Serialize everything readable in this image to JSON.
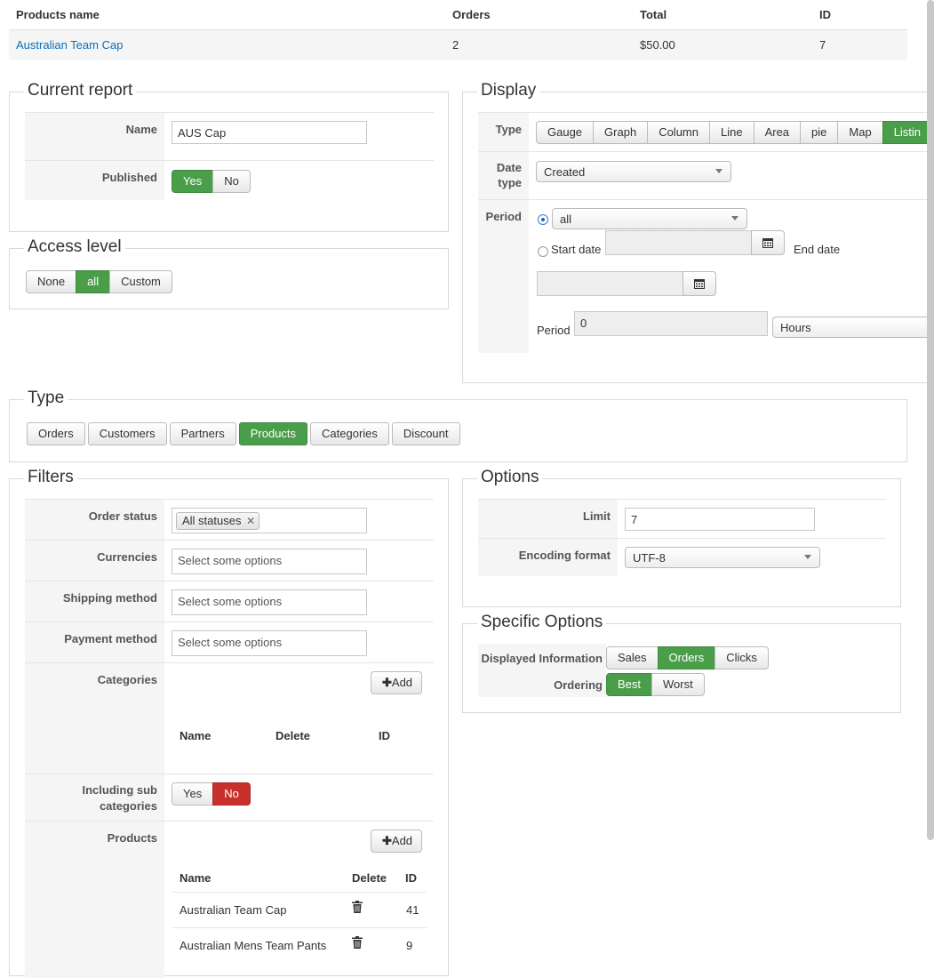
{
  "top_table": {
    "headers": [
      "Products name",
      "Orders",
      "Total",
      "ID"
    ],
    "row": {
      "name": "Australian Team Cap",
      "orders": "2",
      "total": "$50.00",
      "id": "7"
    }
  },
  "current_report": {
    "legend": "Current report",
    "name_label": "Name",
    "name_value": "AUS Cap",
    "published_label": "Published",
    "published_options": [
      "Yes",
      "No"
    ],
    "published_selected": "Yes"
  },
  "access_level": {
    "legend": "Access level",
    "options": [
      "None",
      "all",
      "Custom"
    ],
    "selected": "all"
  },
  "display": {
    "legend": "Display",
    "type_label": "Type",
    "type_options": [
      "Gauge",
      "Graph",
      "Column",
      "Line",
      "Area",
      "pie",
      "Map",
      "Listin"
    ],
    "type_selected": "Listin",
    "date_type_label": "Date type",
    "date_type_value": "Created",
    "period_label": "Period",
    "period_value": "all",
    "start_date_label": "Start date",
    "end_date_label": "End date",
    "period_amount_label": "Period",
    "period_amount_value": "0",
    "period_unit": "Hours"
  },
  "type_section": {
    "legend": "Type",
    "options": [
      "Orders",
      "Customers",
      "Partners",
      "Products",
      "Categories",
      "Discount"
    ],
    "selected": "Products"
  },
  "filters": {
    "legend": "Filters",
    "order_status_label": "Order status",
    "order_status_tag": "All statuses",
    "currencies_label": "Currencies",
    "shipping_label": "Shipping method",
    "payment_label": "Payment method",
    "placeholder": "Select some options",
    "categories_label": "Categories",
    "add_label": "Add",
    "categories_headers": [
      "Name",
      "Delete",
      "ID"
    ],
    "sub_categories_label": "Including sub categories",
    "sub_options": [
      "Yes",
      "No"
    ],
    "sub_selected": "No",
    "products_label": "Products",
    "products_headers": [
      "Name",
      "Delete",
      "ID"
    ],
    "products": [
      {
        "name": "Australian Team Cap",
        "id": "41"
      },
      {
        "name": "Australian Mens Team Pants",
        "id": "9"
      }
    ]
  },
  "options": {
    "legend": "Options",
    "limit_label": "Limit",
    "limit_value": "7",
    "encoding_label": "Encoding format",
    "encoding_value": "UTF-8"
  },
  "specific_options": {
    "legend": "Specific Options",
    "displayed_label": "Displayed Information",
    "displayed_options": [
      "Sales",
      "Orders",
      "Clicks"
    ],
    "displayed_selected": "Orders",
    "ordering_label": "Ordering",
    "ordering_options": [
      "Best",
      "Worst"
    ],
    "ordering_selected": "Best"
  },
  "colors": {
    "accent_green": "#4a9e4a",
    "danger_red": "#c9302c",
    "link_blue": "#0b6fb8"
  }
}
